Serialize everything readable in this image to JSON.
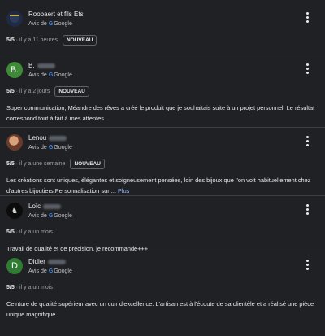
{
  "reviews": [
    {
      "name": "Roobaert et fils Ets",
      "source_prefix": "Avis de",
      "source_brand": "Google",
      "score": "5/5",
      "time": "· il y a 11 heures",
      "badge": "NOUVEAU",
      "text": "",
      "more": ""
    },
    {
      "name": "B.",
      "avatar_letter": "B.",
      "source_prefix": "Avis de",
      "source_brand": "Google",
      "score": "5/5",
      "time": "· il y a 2 jours",
      "badge": "NOUVEAU",
      "text": "Super communication, Méandre des rêves a créé le produit que je souhaitais suite à un projet personnel. Le résultat correspond tout à fait à mes attentes.",
      "more": ""
    },
    {
      "name": "Lenou",
      "source_prefix": "Avis de",
      "source_brand": "Google",
      "score": "5/5",
      "time": "· il y a une semaine",
      "badge": "NOUVEAU",
      "text": "Les créations sont uniques, élégantes et soigneusement pensées, loin des bijoux que l'on voit habituellement chez d'autres bijoutiers.Personnalisation sur ...",
      "more": "Plus"
    },
    {
      "name": "Loïc",
      "source_prefix": "Avis de",
      "source_brand": "Google",
      "score": "5/5",
      "time": "· il y a un mois",
      "badge": "",
      "text": "Travail de qualité et de précision, je recommande+++",
      "more": ""
    },
    {
      "name": "Didier",
      "avatar_letter": "D",
      "source_prefix": "Avis de",
      "source_brand": "Google",
      "score": "5/5",
      "time": "· il y a un mois",
      "badge": "",
      "text": "Ceinture de qualité supérieur avec un cuir d'excellence. L'artisan est à l'écoute de sa clientèle et a réalisé une pièce unique magnifique.",
      "more": ""
    }
  ]
}
